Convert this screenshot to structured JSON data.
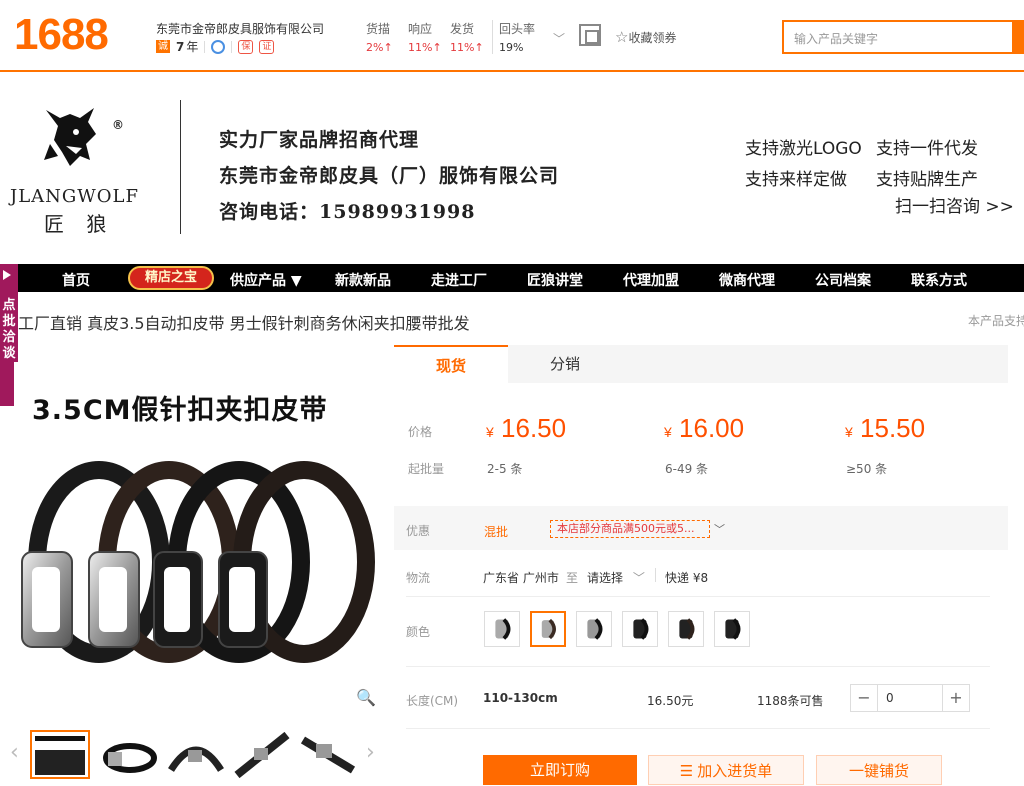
{
  "header": {
    "logo": "1688",
    "shop_name": "东莞市金帝郎皮具服饰有限公司",
    "years": "7",
    "years_unit": "年",
    "metrics": [
      {
        "label": "货描",
        "value": "2%↑"
      },
      {
        "label": "响应",
        "value": "11%↑"
      },
      {
        "label": "发货",
        "value": "11%↑"
      },
      {
        "label": "回头率",
        "value": "19%"
      }
    ],
    "favorite_label": "收藏领券",
    "search_placeholder": "输入产品关键字"
  },
  "banner": {
    "brand_en": "JLANGWOLF",
    "brand_cn": "匠 狼",
    "registered": "®",
    "line1": "实力厂家品牌招商代理",
    "line2": "东莞市金帝郎皮具（厂）服饰有限公司",
    "line3": "咨询电话：15989931998",
    "right1": "支持激光LOGO",
    "right2": "支持一件代发",
    "right3": "支持来样定做",
    "right4": "支持贴牌生产",
    "right5": "扫一扫咨询 >>"
  },
  "nav": {
    "items": [
      "首页",
      "供应产品 ▼",
      "新款新品",
      "走进工厂",
      "匠狼讲堂",
      "代理加盟",
      "微商代理",
      "公司档案",
      "联系方式"
    ],
    "special": "精店之宝"
  },
  "sidetab": {
    "text": "点批洽谈"
  },
  "product": {
    "title": "工厂直销 真皮3.5自动扣皮带 男士假针刺商务休闲夹扣腰带批发",
    "title_right": "本产品支持",
    "image_title": "3.5CM假针扣夹扣皮带"
  },
  "tabs": [
    "现货",
    "分销"
  ],
  "pricing": {
    "price_label": "价格",
    "qty_label": "起批量",
    "currency": "¥",
    "tiers": [
      {
        "price": "16.50",
        "qty": "2-5 条"
      },
      {
        "price": "16.00",
        "qty": "6-49 条"
      },
      {
        "price": "15.50",
        "qty": "≥50 条"
      }
    ]
  },
  "promo": {
    "label": "优惠",
    "tag": "混批",
    "text": "本店部分商品满500元或5..."
  },
  "logistics": {
    "label": "物流",
    "from": "广东省 广州市",
    "to_word": "至",
    "select": "请选择",
    "express": "快递 ¥8"
  },
  "color": {
    "label": "颜色"
  },
  "length": {
    "label": "长度(CM)",
    "value": "110-130cm",
    "price": "16.50元",
    "stock": "1188条可售",
    "quantity": "0"
  },
  "buttons": {
    "buy": "立即订购",
    "cart": "加入进货单",
    "one_click": "一键铺货"
  },
  "colors": {
    "accent": "#ff6a00",
    "nav_bg": "#000000",
    "sidetab": "#a0195c"
  }
}
